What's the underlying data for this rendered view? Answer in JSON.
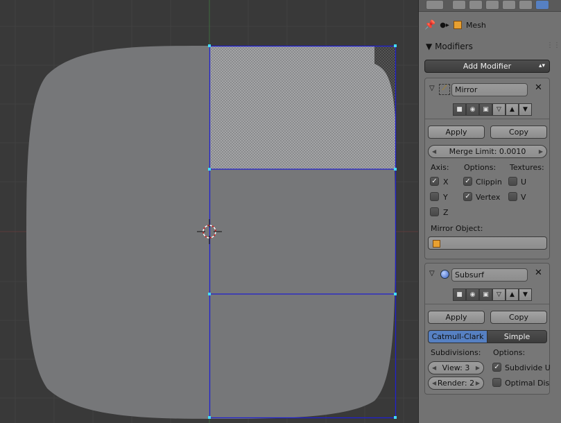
{
  "context": {
    "object_label": "Mesh"
  },
  "modifiers_panel": {
    "title": "Modifiers",
    "add_modifier_label": "Add Modifier",
    "mirror": {
      "name": "Mirror",
      "apply_label": "Apply",
      "copy_label": "Copy",
      "merge_limit_label": "Merge Limit: 0.0010",
      "axis_header": "Axis:",
      "options_header": "Options:",
      "textures_header": "Textures:",
      "axis": [
        {
          "label": "X",
          "checked": true
        },
        {
          "label": "Y",
          "checked": false
        },
        {
          "label": "Z",
          "checked": false
        }
      ],
      "options": [
        {
          "label": "Clippin",
          "checked": true
        },
        {
          "label": "Vertex",
          "checked": true
        }
      ],
      "textures": [
        {
          "label": "U",
          "checked": false
        },
        {
          "label": "V",
          "checked": false
        }
      ],
      "mirror_object_label": "Mirror Object:"
    },
    "subsurf": {
      "name": "Subsurf",
      "apply_label": "Apply",
      "copy_label": "Copy",
      "mode_catmull": "Catmull-Clark",
      "mode_simple": "Simple",
      "subdivisions_header": "Subdivisions:",
      "options_header": "Options:",
      "view_label": "View: 3",
      "render_label": "Render: 2",
      "options": [
        {
          "label": "Subdivide U",
          "checked": true
        },
        {
          "label": "Optimal Dis",
          "checked": false
        }
      ]
    }
  },
  "colors": {
    "viewport_bg": "#393939",
    "mesh_fill": "#767779",
    "selection_blue": "#2020d0",
    "vertex_cyan": "#44ddff",
    "active_tab": "#5680c2"
  }
}
